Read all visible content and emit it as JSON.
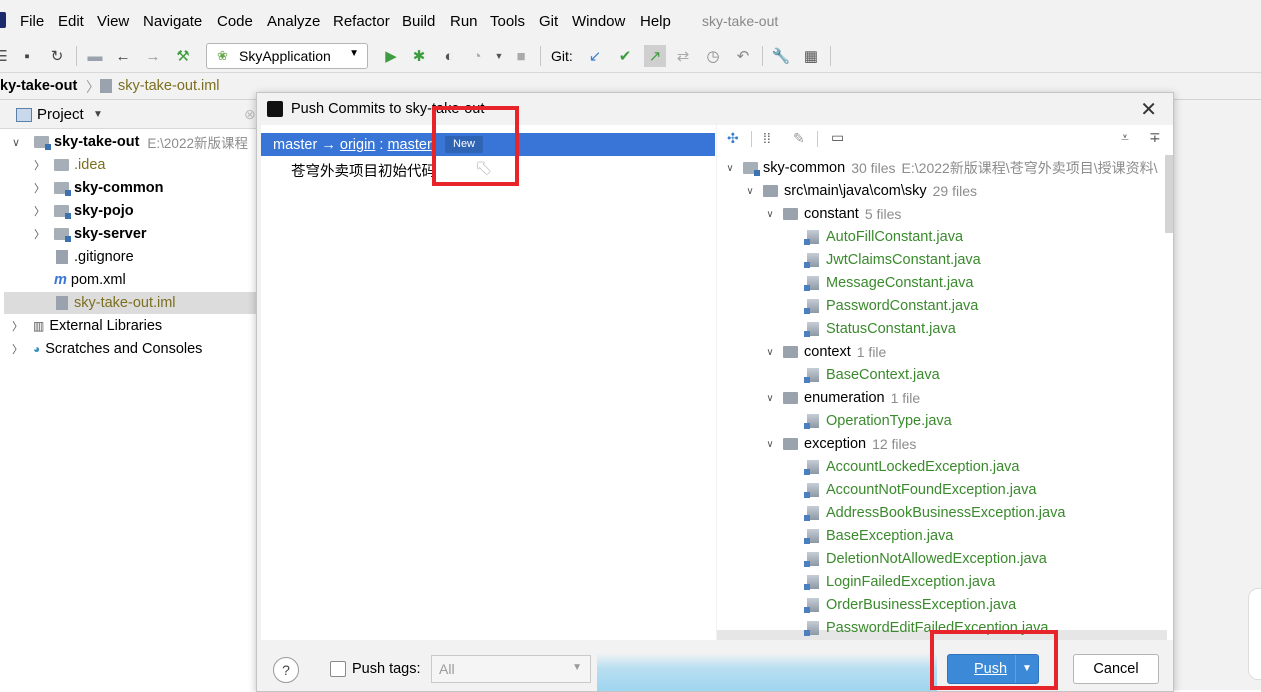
{
  "menubar": {
    "items": [
      "File",
      "Edit",
      "View",
      "Navigate",
      "Code",
      "Analyze",
      "Refactor",
      "Build",
      "Run",
      "Tools",
      "Git",
      "Window",
      "Help"
    ],
    "app_title": "sky-take-out"
  },
  "toolbar": {
    "run_config": "SkyApplication",
    "git_label": "Git:"
  },
  "breadcrumb": {
    "project": "ky-take-out",
    "file": "sky-take-out.iml"
  },
  "project_panel": {
    "header": "Project",
    "tree": [
      {
        "label": "sky-take-out",
        "path": "E:\\2022新版课程",
        "bold": true,
        "expanded": true
      },
      {
        "label": ".idea"
      },
      {
        "label": "sky-common",
        "bold": true
      },
      {
        "label": "sky-pojo",
        "bold": true
      },
      {
        "label": "sky-server",
        "bold": true
      },
      {
        "label": ".gitignore"
      },
      {
        "label": "pom.xml"
      },
      {
        "label": "sky-take-out.iml",
        "selected": true
      },
      {
        "label": "External Libraries"
      },
      {
        "label": "Scratches and Consoles"
      }
    ]
  },
  "dialog": {
    "title": "Push Commits to sky-take-out",
    "branch": {
      "local": "master",
      "arrow": "→",
      "remote": "origin",
      "separator": ":",
      "remote_branch": "master",
      "badge": "New"
    },
    "commit_message": "苍穹外卖项目初始代码",
    "files": {
      "module": {
        "name": "sky-common",
        "count": "30 files",
        "path": "E:\\2022新版课程\\苍穹外卖项目\\授课资料\\"
      },
      "package": {
        "name": "src\\main\\java\\com\\sky",
        "count": "29 files"
      },
      "groups": [
        {
          "name": "constant",
          "count": "5 files",
          "files": [
            "AutoFillConstant.java",
            "JwtClaimsConstant.java",
            "MessageConstant.java",
            "PasswordConstant.java",
            "StatusConstant.java"
          ]
        },
        {
          "name": "context",
          "count": "1 file",
          "files": [
            "BaseContext.java"
          ]
        },
        {
          "name": "enumeration",
          "count": "1 file",
          "files": [
            "OperationType.java"
          ]
        },
        {
          "name": "exception",
          "count": "12 files",
          "files": [
            "AccountLockedException.java",
            "AccountNotFoundException.java",
            "AddressBookBusinessException.java",
            "BaseException.java",
            "DeletionNotAllowedException.java",
            "LoginFailedException.java",
            "OrderBusinessException.java",
            "PasswordEditFailedException.java"
          ]
        }
      ]
    },
    "bottom": {
      "help": "?",
      "push_tags_label": "Push tags:",
      "tags_value": "All",
      "push_label": "Push",
      "cancel_label": "Cancel"
    }
  },
  "colors": {
    "accent": "#3c8ad7",
    "selection": "#3875d6",
    "java_file": "#3a8a2d",
    "highlight_box": "#e8242b"
  }
}
